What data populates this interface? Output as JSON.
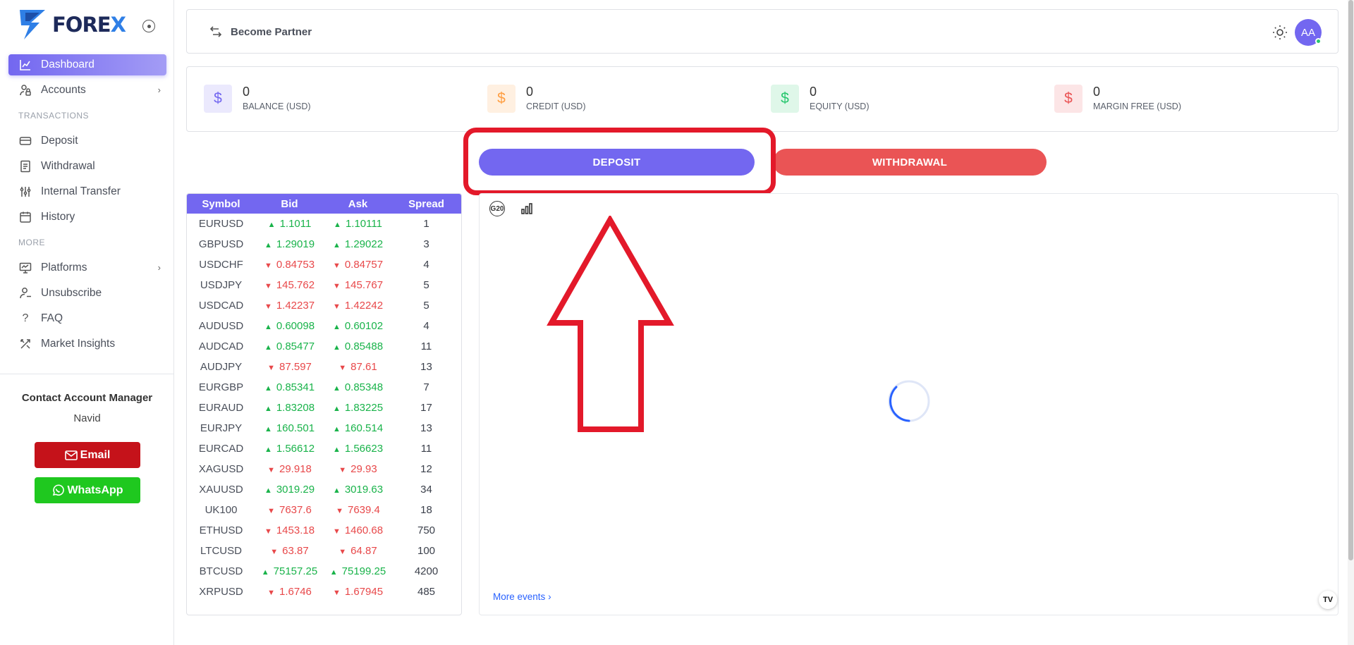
{
  "brand": {
    "text_main": "FORE",
    "text_x": "X"
  },
  "sidebar": {
    "items": [
      {
        "label": "Dashboard",
        "icon": "chart-icon"
      },
      {
        "label": "Accounts",
        "icon": "user-lock-icon"
      },
      {
        "label": "Deposit",
        "icon": "card-icon"
      },
      {
        "label": "Withdrawal",
        "icon": "receipt-icon"
      },
      {
        "label": "Internal Transfer",
        "icon": "transfer-icon"
      },
      {
        "label": "History",
        "icon": "calendar-icon"
      },
      {
        "label": "Platforms",
        "icon": "monitor-icon"
      },
      {
        "label": "Unsubscribe",
        "icon": "user-minus-icon"
      },
      {
        "label": "FAQ",
        "icon": "question-icon"
      },
      {
        "label": "Market Insights",
        "icon": "tools-icon"
      }
    ],
    "section_transactions": "TRANSACTIONS",
    "section_more": "MORE",
    "contact_title": "Contact Account Manager",
    "contact_name": "Navid",
    "email_label": "Email",
    "whatsapp_label": "WhatsApp"
  },
  "header": {
    "partner_label": "Become Partner",
    "avatar_initials": "AA"
  },
  "stats": [
    {
      "value": "0",
      "label": "BALANCE (USD)",
      "color": "#7367f0",
      "bg": "#ebe9fd"
    },
    {
      "value": "0",
      "label": "CREDIT (USD)",
      "color": "#ff9f43",
      "bg": "#fff0e1"
    },
    {
      "value": "0",
      "label": "EQUITY (USD)",
      "color": "#28c76f",
      "bg": "#dff7e9"
    },
    {
      "value": "0",
      "label": "MARGIN FREE (USD)",
      "color": "#ea5455",
      "bg": "#fce5e6"
    }
  ],
  "actions": {
    "deposit": "DEPOSIT",
    "withdrawal": "WITHDRAWAL"
  },
  "quotes": {
    "headers": [
      "Symbol",
      "Bid",
      "Ask",
      "Spread"
    ],
    "rows": [
      {
        "symbol": "EURUSD",
        "bid": "1.1011",
        "ask": "1.10111",
        "spread": "1",
        "dir": "up"
      },
      {
        "symbol": "GBPUSD",
        "bid": "1.29019",
        "ask": "1.29022",
        "spread": "3",
        "dir": "up"
      },
      {
        "symbol": "USDCHF",
        "bid": "0.84753",
        "ask": "0.84757",
        "spread": "4",
        "dir": "down"
      },
      {
        "symbol": "USDJPY",
        "bid": "145.762",
        "ask": "145.767",
        "spread": "5",
        "dir": "down"
      },
      {
        "symbol": "USDCAD",
        "bid": "1.42237",
        "ask": "1.42242",
        "spread": "5",
        "dir": "down"
      },
      {
        "symbol": "AUDUSD",
        "bid": "0.60098",
        "ask": "0.60102",
        "spread": "4",
        "dir": "up"
      },
      {
        "symbol": "AUDCAD",
        "bid": "0.85477",
        "ask": "0.85488",
        "spread": "11",
        "dir": "up"
      },
      {
        "symbol": "AUDJPY",
        "bid": "87.597",
        "ask": "87.61",
        "spread": "13",
        "dir": "down"
      },
      {
        "symbol": "EURGBP",
        "bid": "0.85341",
        "ask": "0.85348",
        "spread": "7",
        "dir": "up"
      },
      {
        "symbol": "EURAUD",
        "bid": "1.83208",
        "ask": "1.83225",
        "spread": "17",
        "dir": "up"
      },
      {
        "symbol": "EURJPY",
        "bid": "160.501",
        "ask": "160.514",
        "spread": "13",
        "dir": "up"
      },
      {
        "symbol": "EURCAD",
        "bid": "1.56612",
        "ask": "1.56623",
        "spread": "11",
        "dir": "up"
      },
      {
        "symbol": "XAGUSD",
        "bid": "29.918",
        "ask": "29.93",
        "spread": "12",
        "dir": "down"
      },
      {
        "symbol": "XAUUSD",
        "bid": "3019.29",
        "ask": "3019.63",
        "spread": "34",
        "dir": "up"
      },
      {
        "symbol": "UK100",
        "bid": "7637.6",
        "ask": "7639.4",
        "spread": "18",
        "dir": "down"
      },
      {
        "symbol": "ETHUSD",
        "bid": "1453.18",
        "ask": "1460.68",
        "spread": "750",
        "dir": "down"
      },
      {
        "symbol": "LTCUSD",
        "bid": "63.87",
        "ask": "64.87",
        "spread": "100",
        "dir": "down"
      },
      {
        "symbol": "BTCUSD",
        "bid": "75157.25",
        "ask": "75199.25",
        "spread": "4200",
        "dir": "up"
      },
      {
        "symbol": "XRPUSD",
        "bid": "1.6746",
        "ask": "1.67945",
        "spread": "485",
        "dir": "down"
      }
    ]
  },
  "calendar": {
    "g20_label": "G20",
    "more_events": "More events",
    "tv_label": "TV"
  },
  "colors": {
    "accent": "#7367f0",
    "danger": "#ea5455",
    "up": "#19b34a",
    "down": "#e8484a",
    "highlight": "#e3192a"
  }
}
